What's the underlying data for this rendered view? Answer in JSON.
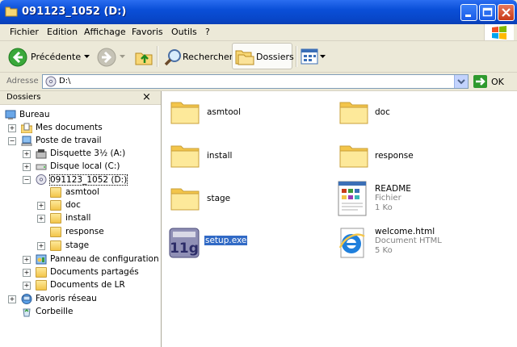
{
  "window": {
    "title": "091123_1052 (D:)"
  },
  "menu": [
    "Fichier",
    "Edition",
    "Affichage",
    "Favoris",
    "Outils",
    "?"
  ],
  "toolbar": {
    "back_label": "Précédente",
    "search_label": "Rechercher",
    "folders_label": "Dossiers"
  },
  "address": {
    "label": "Adresse",
    "value": "D:\\",
    "go_label": "OK"
  },
  "folders_pane": {
    "title": "Dossiers",
    "close": "×",
    "tree": [
      {
        "label": "Bureau",
        "icon": "desktop-icon"
      },
      {
        "label": "Mes documents",
        "icon": "my-documents-icon"
      },
      {
        "label": "Poste de travail",
        "icon": "my-computer-icon"
      },
      {
        "label": "Disquette 3½ (A:)",
        "icon": "floppy-icon"
      },
      {
        "label": "Disque local (C:)",
        "icon": "hard-drive-icon"
      },
      {
        "label": "091123_1052 (D:)",
        "icon": "cd-drive-icon"
      },
      {
        "label": "asmtool",
        "icon": "folder-icon"
      },
      {
        "label": "doc",
        "icon": "folder-icon"
      },
      {
        "label": "install",
        "icon": "folder-icon"
      },
      {
        "label": "response",
        "icon": "folder-icon"
      },
      {
        "label": "stage",
        "icon": "folder-icon"
      },
      {
        "label": "Panneau de configuration",
        "icon": "control-panel-icon"
      },
      {
        "label": "Documents partagés",
        "icon": "folder-icon"
      },
      {
        "label": "Documents de LR",
        "icon": "folder-icon"
      },
      {
        "label": "Favoris réseau",
        "icon": "network-icon"
      },
      {
        "label": "Corbeille",
        "icon": "recycle-bin-icon"
      }
    ]
  },
  "files": [
    {
      "name": "asmtool",
      "type": "folder"
    },
    {
      "name": "doc",
      "type": "folder"
    },
    {
      "name": "install",
      "type": "folder"
    },
    {
      "name": "response",
      "type": "folder"
    },
    {
      "name": "stage",
      "type": "folder"
    },
    {
      "name": "README",
      "type": "file",
      "kind": "Fichier",
      "size": "1 Ko"
    },
    {
      "name": "setup.exe",
      "type": "exe"
    },
    {
      "name": "welcome.html",
      "type": "html",
      "kind": "Document HTML",
      "size": "5 Ko"
    }
  ]
}
